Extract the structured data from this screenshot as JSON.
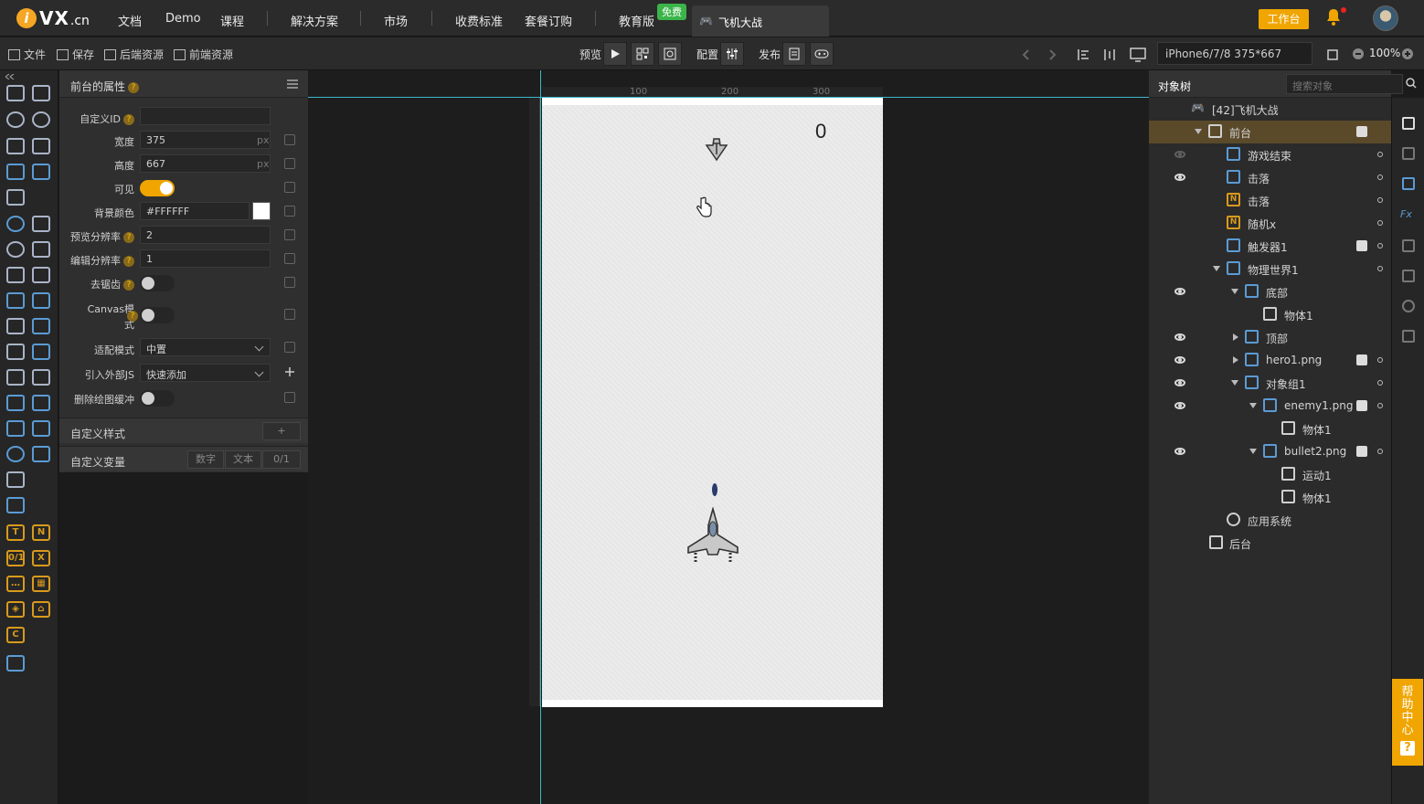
{
  "nav": {
    "logo_i": "i",
    "logo_vx": "VX",
    "logo_cn": ".cn",
    "links": [
      "文档",
      "Demo",
      "课程",
      "解决方案",
      "市场",
      "收费标准",
      "套餐订购",
      "教育版"
    ],
    "free_badge": "免费",
    "project_tab": "飞机大战",
    "workbench": "工作台"
  },
  "toolbar": {
    "file": "文件",
    "save": "保存",
    "backend_res": "后端资源",
    "frontend_res": "前端资源",
    "preview": "预览",
    "config": "配置",
    "publish": "发布",
    "device": "iPhone6/7/8 375*667",
    "zoom": "100%"
  },
  "props": {
    "title": "前台的属性",
    "rows": {
      "custom_id_label": "自定义ID",
      "width_label": "宽度",
      "width_value": "375",
      "height_label": "高度",
      "height_value": "667",
      "unit": "px",
      "visible_label": "可见",
      "bg_label": "背景颜色",
      "bg_value": "#FFFFFF",
      "preview_ratio_label": "预览分辨率",
      "preview_ratio_value": "2",
      "edit_ratio_label": "编辑分辨率",
      "edit_ratio_value": "1",
      "antialias_label": "去锯齿",
      "canvas_mode_label_1": "Canvas模",
      "canvas_mode_label_2": "式",
      "fit_mode_label": "适配模式",
      "fit_mode_value": "中置",
      "external_js_label": "引入外部JS",
      "external_js_value": "快速添加",
      "clear_buffer_label": "删除绘图缓冲"
    },
    "custom_style": "自定义样式",
    "custom_vars": "自定义变量",
    "var_tabs": [
      "数字",
      "文本",
      "0/1"
    ]
  },
  "canvas": {
    "score": "0",
    "ruler_top": [
      "100",
      "200",
      "300"
    ]
  },
  "tree": {
    "tab": "对象树",
    "search_placeholder": "搜索对象",
    "rows": [
      {
        "label": "[42]飞机大战"
      },
      {
        "label": "前台"
      },
      {
        "label": "游戏结束"
      },
      {
        "label": "击落"
      },
      {
        "label": "击落"
      },
      {
        "label": "随机x"
      },
      {
        "label": "触发器1"
      },
      {
        "label": "物理世界1"
      },
      {
        "label": "底部"
      },
      {
        "label": "物体1"
      },
      {
        "label": "顶部"
      },
      {
        "label": "hero1.png"
      },
      {
        "label": "对象组1"
      },
      {
        "label": "enemy1.png"
      },
      {
        "label": "物体1"
      },
      {
        "label": "bullet2.png"
      },
      {
        "label": "运动1"
      },
      {
        "label": "物体1"
      },
      {
        "label": "应用系统"
      },
      {
        "label": "后台"
      }
    ]
  },
  "help": {
    "chars": [
      "帮",
      "助",
      "中",
      "心"
    ],
    "q": "?"
  },
  "colors": {
    "accent": "#f0a500",
    "guide": "#3fb8c8",
    "free_badge": "#3bb54a"
  }
}
